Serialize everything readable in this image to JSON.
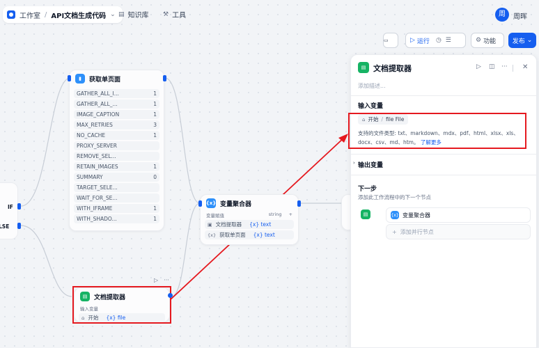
{
  "topbar": {
    "workspace": "工作室",
    "app_name": "API文档生成代码",
    "knowledge": "知识库",
    "tools": "工具",
    "avatar_initial": "周",
    "username": "周晖"
  },
  "toolbar": {
    "run": "运行",
    "features": "功能",
    "publish": "发布"
  },
  "if_node": {
    "if_label": "IF",
    "else_label": "ELSE"
  },
  "fetch_node": {
    "title": "获取单页面",
    "vars": [
      {
        "name": "GATHER_ALL_I...",
        "value": "1"
      },
      {
        "name": "GATHER_ALL_...",
        "value": "1"
      },
      {
        "name": "IMAGE_CAPTION",
        "value": "1"
      },
      {
        "name": "MAX_RETRIES",
        "value": "3"
      },
      {
        "name": "NO_CACHE",
        "value": "1"
      },
      {
        "name": "PROXY_SERVER",
        "value": ""
      },
      {
        "name": "REMOVE_SEL...",
        "value": ""
      },
      {
        "name": "RETAIN_IMAGES",
        "value": "1"
      },
      {
        "name": "SUMMARY",
        "value": "0"
      },
      {
        "name": "TARGET_SELE...",
        "value": ""
      },
      {
        "name": "WAIT_FOR_SE...",
        "value": ""
      },
      {
        "name": "WITH_IFRAME",
        "value": "1"
      },
      {
        "name": "WITH_SHADO...",
        "value": "1"
      }
    ]
  },
  "aggregator_node": {
    "title": "变量聚合器",
    "var_label": "变量赋值",
    "type": "string",
    "add": "+",
    "rows": [
      {
        "source": "文档提取器",
        "var": "{x} text"
      },
      {
        "source": "获取单页面",
        "var": "{x} text"
      }
    ]
  },
  "extractor_node": {
    "title": "文档提取器",
    "input_label": "输入变量",
    "source": "开始",
    "var": "{x} file"
  },
  "panel": {
    "title": "文档提取器",
    "description_placeholder": "添加描述...",
    "input_title": "输入变量",
    "input_source": "开始",
    "input_sep": "/",
    "input_var": "file File",
    "support_text": "支持的文件类型: txt、markdown、mdx、pdf、html、xlsx、xls、docx、csv、md、htm。",
    "support_link": "了解更多",
    "output_title": "输出变量",
    "next_title": "下一步",
    "next_desc": "添加此工作流程中的下一个节点",
    "next_node": "变量聚合器",
    "add_parallel": "添加并行节点"
  },
  "colors": {
    "accent": "#155eef",
    "highlight": "#e5191f",
    "node_green": "#16b364",
    "node_blue": "#2e90fa",
    "node_indigo": "#444ce7"
  }
}
